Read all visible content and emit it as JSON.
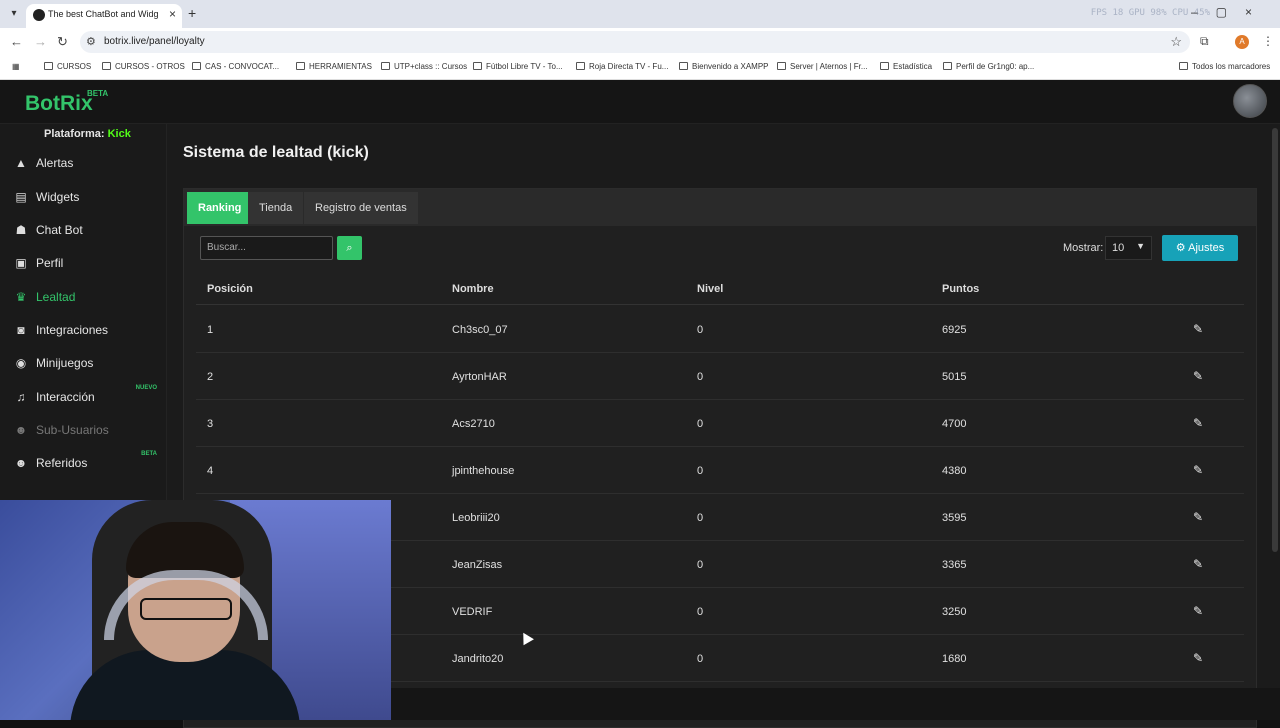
{
  "browser": {
    "tab_title": "The best ChatBot and Widgets",
    "url": "botrix.live/panel/loyalty",
    "perf": "FPS 18   GPU 98%   CPU 45%",
    "avatar_letter": "A",
    "bookmarks": [
      "CURSOS",
      "CURSOS - OTROS",
      "CAS - CONVOCAT...",
      "HERRAMIENTAS",
      "UTP+class :: Cursos",
      "Fútbol Libre TV - To...",
      "Roja Directa TV - Fu...",
      "Bienvenido a XAMPP",
      "Server | Aternos | Fr...",
      "Estadística",
      "Perfil de Gr1ng0: ap...",
      "Todos los marcadores"
    ]
  },
  "app": {
    "logo": "BotRix",
    "logo_badge": "BETA",
    "platform_label": "Plataforma:",
    "platform_value": "Kick"
  },
  "sidebar": {
    "items": [
      {
        "label": "Alertas",
        "icon": "warning-icon"
      },
      {
        "label": "Widgets",
        "icon": "widgets-icon"
      },
      {
        "label": "Chat Bot",
        "icon": "robot-icon"
      },
      {
        "label": "Perfil",
        "icon": "id-card-icon"
      },
      {
        "label": "Lealtad",
        "icon": "trophy-icon"
      },
      {
        "label": "Integraciones",
        "icon": "puzzle-icon"
      },
      {
        "label": "Minijuegos",
        "icon": "gamepad-icon"
      },
      {
        "label": "Interacción",
        "icon": "music-icon",
        "badge": "NUEVO"
      },
      {
        "label": "Sub-Usuarios",
        "icon": "users-icon"
      },
      {
        "label": "Referidos",
        "icon": "referrals-icon",
        "badge": "BETA"
      }
    ]
  },
  "main": {
    "title": "Sistema de lealtad (kick)",
    "tabs": [
      "Ranking",
      "Tienda",
      "Registro de ventas"
    ],
    "search_placeholder": "Buscar...",
    "show_label": "Mostrar:",
    "show_value": "10",
    "settings_label": "Ajustes",
    "columns": [
      "Posición",
      "Nombre",
      "Nivel",
      "Puntos"
    ],
    "rows": [
      {
        "pos": "1",
        "name": "Ch3sc0_07",
        "level": "0",
        "points": "6925"
      },
      {
        "pos": "2",
        "name": "AyrtonHAR",
        "level": "0",
        "points": "5015"
      },
      {
        "pos": "3",
        "name": "Acs2710",
        "level": "0",
        "points": "4700"
      },
      {
        "pos": "4",
        "name": "jpinthehouse",
        "level": "0",
        "points": "4380"
      },
      {
        "pos": "",
        "name": "Leobriii20",
        "level": "0",
        "points": "3595"
      },
      {
        "pos": "",
        "name": "JeanZisas",
        "level": "0",
        "points": "3365"
      },
      {
        "pos": "",
        "name": "VEDRIF",
        "level": "0",
        "points": "3250"
      },
      {
        "pos": "",
        "name": "Jandrito20",
        "level": "0",
        "points": "1680"
      }
    ]
  },
  "colors": {
    "accent": "#33c46a",
    "kick": "#53fc18",
    "info": "#17a2b8"
  }
}
